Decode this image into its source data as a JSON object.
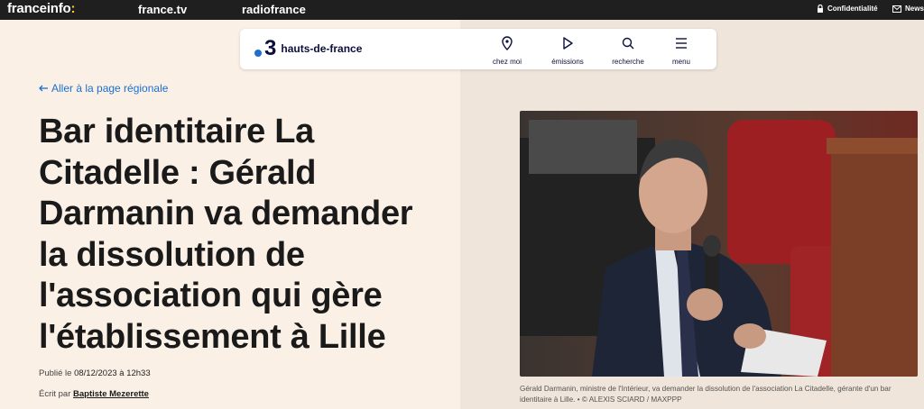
{
  "topbar": {
    "brand": "franceinfo",
    "brand_colon": ":",
    "nav_francetv": "france.tv",
    "nav_radiofrance": "radiofrance",
    "privacy": "Confidentialité",
    "newsletter": "News"
  },
  "header": {
    "channel_number": "3",
    "region": "hauts-de-france",
    "items": [
      {
        "label": "chez moi",
        "icon": "location-pin-icon"
      },
      {
        "label": "émissions",
        "icon": "play-icon"
      },
      {
        "label": "recherche",
        "icon": "search-icon"
      },
      {
        "label": "menu",
        "icon": "hamburger-icon"
      }
    ]
  },
  "article": {
    "back_link": "Aller à la page régionale",
    "title": "Bar identitaire La Citadelle : Gérald Darmanin va demander la dissolution de l'association qui gère l'établissement à Lille",
    "published_label": "Publié le",
    "published_date": "08/12/2023 à 12h33",
    "author_label": "Écrit par",
    "author": "Baptiste Mezerette",
    "caption": "Gérald Darmanin, ministre de l'Intérieur, va demander la dissolution de l'association La Citadelle, gérante d'un bar identitaire à Lille. • © ALEXIS SCIARD / MAXPPP"
  },
  "colors": {
    "accent_blue": "#1d6fd0",
    "brand_yellow": "#ffcc33",
    "topbar_bg": "#1f1f1f",
    "page_bg": "#faf0e6"
  }
}
